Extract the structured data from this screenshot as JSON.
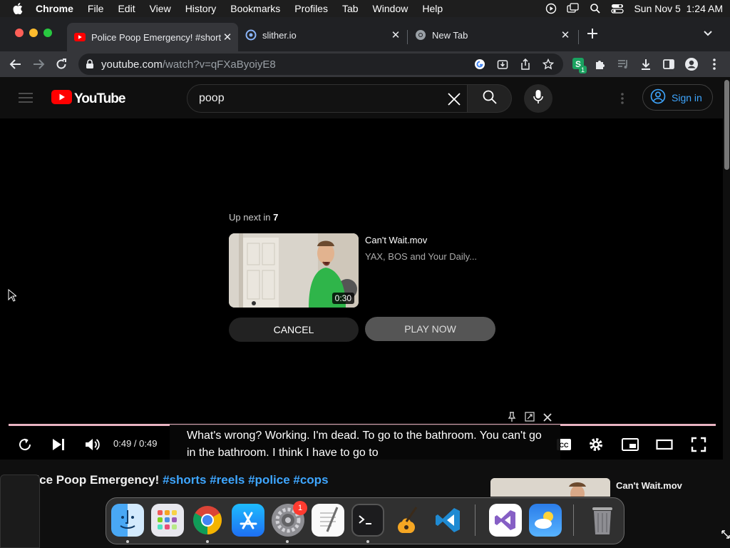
{
  "menubar": {
    "app_name": "Chrome",
    "items": [
      "File",
      "Edit",
      "View",
      "History",
      "Bookmarks",
      "Profiles",
      "Tab",
      "Window",
      "Help"
    ],
    "clock": "Sun Nov 5  1:24 AM"
  },
  "tabs": [
    {
      "title": "Police Poop Emergency! #shorts",
      "favicon": "youtube-icon",
      "active": true
    },
    {
      "title": "slither.io",
      "favicon": "slither-icon",
      "active": false
    },
    {
      "title": "New Tab",
      "favicon": "chrome-icon",
      "active": false
    }
  ],
  "omnibox": {
    "host": "youtube.com",
    "path": "/watch?v=qFXaByoiyE8"
  },
  "extensions": {
    "badge_count": "1"
  },
  "youtube": {
    "logo_text": "YouTube",
    "search_query": "poop",
    "sign_in_label": "Sign in",
    "up_next_prefix": "Up next in",
    "up_next_seconds": "7",
    "next_video": {
      "title": "Can't Wait.mov",
      "channel": "YAX, BOS and Your Daily...",
      "duration": "0:30"
    },
    "cancel_label": "CANCEL",
    "play_now_label": "PLAY NOW",
    "time_display": "0:49 / 0:49",
    "progress_fraction": 1.0,
    "captions": "What's wrong? Working. I'm dead. To go to the bathroom. You can't go in the bathroom. I think I have to go to",
    "video_title_plain": "Police Poop Emergency!",
    "video_title_tags": "#shorts #reels #police #cops",
    "sidebar_video_title": "Can't Wait.mov"
  },
  "dock": {
    "apps": [
      "finder-icon",
      "launchpad-icon",
      "chrome-icon",
      "app-store-icon",
      "system-settings-icon",
      "textedit-icon",
      "terminal-icon",
      "garageband-icon",
      "vscode-icon",
      "visual-studio-icon",
      "weather-icon",
      "trash-icon"
    ],
    "settings_badge": "1"
  },
  "colors": {
    "youtube_red": "#ff0000",
    "link_blue": "#3ea6ff",
    "progress_pink": "#e8b3c1"
  }
}
